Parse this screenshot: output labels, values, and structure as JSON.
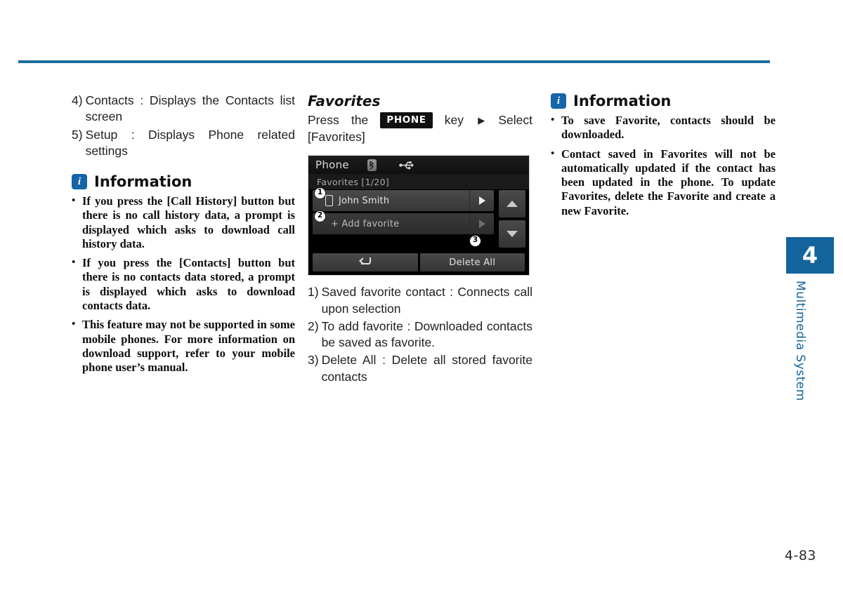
{
  "page": {
    "number": "4-83",
    "chapter_tab_number": "4",
    "chapter_tab_label": "Multimedia System",
    "accent_color": "#13639d",
    "rule_color": "#1b6e9c"
  },
  "left_column": {
    "numbered_items": [
      {
        "marker": "4)",
        "text": "Contacts : Displays the Contacts list screen"
      },
      {
        "marker": "5)",
        "text": "Setup : Displays Phone related settings"
      }
    ],
    "information": {
      "icon": "info-icon",
      "title": "Information",
      "bullets": [
        "If you press the [Call History] button but there is no call history data, a prompt is displayed which asks to download call history data.",
        "If you press the [Contacts] button but there is no contacts data stored, a prompt is displayed which asks to download contacts data.",
        "This feature may not be supported in some mobile phones. For more information on download support, refer to your mobile phone user’s manual."
      ]
    }
  },
  "middle_column": {
    "section_title": "Favorites",
    "path": {
      "press": "Press",
      "the": "the",
      "hard_key": "PHONE",
      "key_word": "key",
      "separator": "▶",
      "select": "Select",
      "target": "[Favorites]"
    },
    "device_screenshot": {
      "header": {
        "title": "Phone",
        "icons": [
          "bluetooth-icon",
          "usb-icon"
        ]
      },
      "subbar": "Favorites [1/20]",
      "rows": [
        {
          "callout": "①",
          "icon": "mobile-phone-icon",
          "label": "John Smith",
          "go_icon": "play-arrow-icon",
          "enabled": true
        },
        {
          "callout": "②",
          "icon": "",
          "label": "+ Add favorite",
          "go_icon": "play-arrow-icon",
          "enabled": false
        }
      ],
      "scroll": {
        "up": "scroll-up-icon",
        "down": "scroll-down-icon"
      },
      "footer": [
        {
          "label": "",
          "icon": "back-arrow-icon",
          "callout": ""
        },
        {
          "label": "Delete All",
          "icon": "",
          "callout": "③"
        }
      ]
    },
    "numbered_items": [
      {
        "marker": "1)",
        "text": "Saved favorite contact : Connects call upon selection"
      },
      {
        "marker": "2)",
        "text": "To add favorite : Downloaded contacts be saved as favorite."
      },
      {
        "marker": "3)",
        "text": "Delete All : Delete all stored favorite contacts"
      }
    ]
  },
  "right_column": {
    "information": {
      "icon": "info-icon",
      "title": "Information",
      "bullets": [
        "To save Favorite, contacts should be downloaded.",
        "Contact saved in Favorites will not be automatically updated if the contact has been updated in the phone. To update Favorites, delete the Favorite and create a new Favorite."
      ]
    }
  }
}
